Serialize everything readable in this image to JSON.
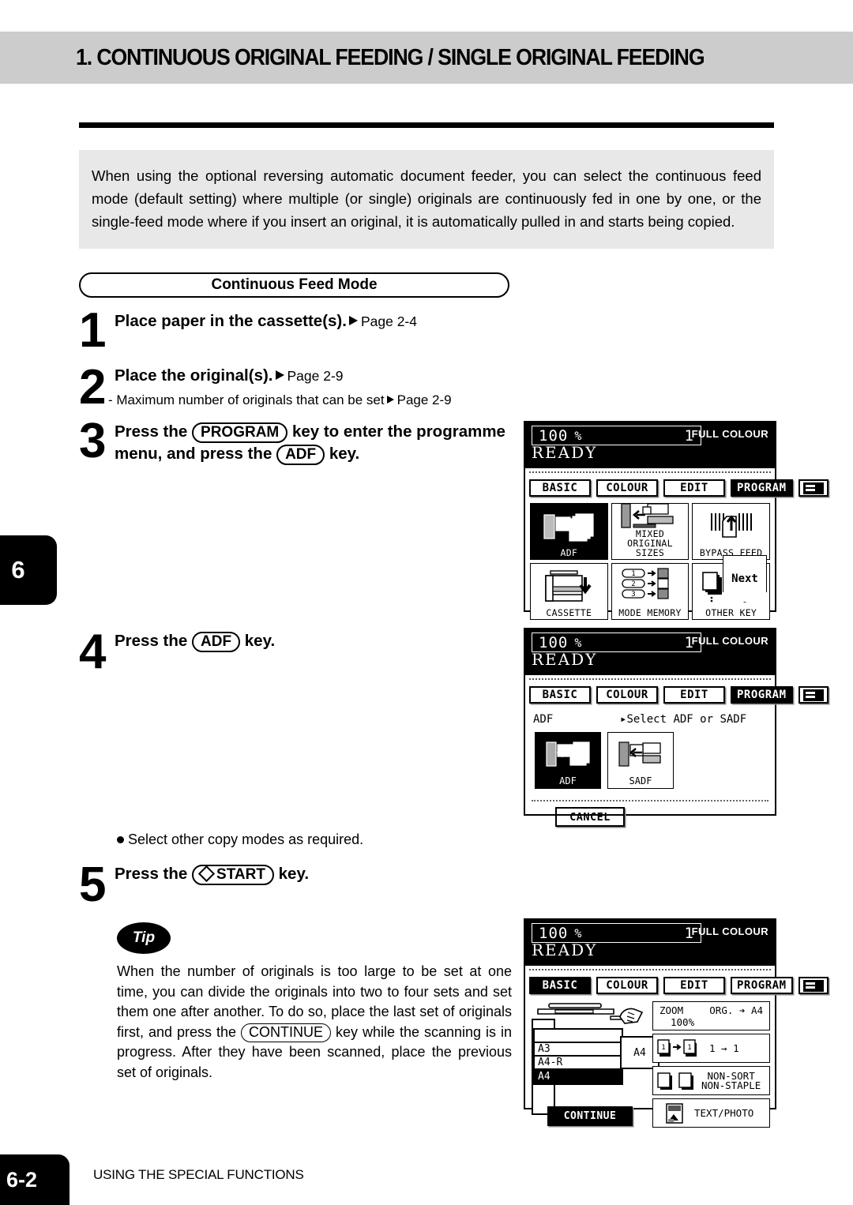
{
  "header": {
    "title": "1. CONTINUOUS ORIGINAL FEEDING / SINGLE ORIGINAL FEEDING"
  },
  "intro": {
    "text": "When using the optional reversing automatic document feeder, you can select the continuous feed mode (default setting) where multiple (or single) originals are continuously fed in one by one, or the single-feed mode where if you insert an original, it is automatically pulled in and starts being copied."
  },
  "mode_pill": {
    "label": "Continuous Feed Mode"
  },
  "steps": [
    {
      "num": "1",
      "title": "Place paper in the cassette(s).",
      "ref": "Page 2-4"
    },
    {
      "num": "2",
      "title": "Place the original(s).",
      "ref": "Page 2-9",
      "note_prefix": "-  Maximum number of originals that can be set",
      "note_ref": "Page 2-9"
    },
    {
      "num": "3",
      "title_a": "Press the",
      "key_a": "PROGRAM",
      "title_b": "key to enter the programme",
      "title_c": "menu, and press the",
      "key_b": "ADF",
      "title_d": "key."
    },
    {
      "num": "4",
      "title_a": "Press the",
      "key_a": "ADF",
      "title_b": "key."
    },
    {
      "num": "5",
      "title_a": "Press the",
      "key_a": "START",
      "title_b": "key."
    }
  ],
  "bullet": {
    "text": "Select other copy modes as required."
  },
  "tip": {
    "badge": "Tip",
    "text_a": "When the number of originals is too large to be set at one time, you can divide the originals into two to four sets and set them one after another.  To do so, place the last set of originals first, and press the",
    "key": "CONTINUE",
    "text_b": "key while the scanning is in progress.  After they have been scanned, place the previous set of originals."
  },
  "lcd_common": {
    "ratio": "100",
    "percent_symbol": "%",
    "copy_count": "1",
    "colour_mode": "FULL COLOUR",
    "status": "READY",
    "tabs": [
      "BASIC",
      "COLOUR",
      "EDIT",
      "PROGRAM"
    ],
    "keyboard_icon": "keyboard-icon"
  },
  "lcd_panel_1": {
    "selected_tab": "PROGRAM",
    "buttons": [
      {
        "label": "ADF",
        "selected": true,
        "icon": "adf-icon"
      },
      {
        "label": "MIXED\nORIGINAL SIZES",
        "label_l1": "MIXED",
        "label_l2": "ORIGINAL SIZES",
        "selected": false,
        "icon": "mixed-original-sizes-icon"
      },
      {
        "label": "BYPASS FEED",
        "selected": false,
        "icon": "bypass-feed-icon"
      },
      {
        "label": "CASSETTE",
        "selected": false,
        "icon": "cassette-icon"
      },
      {
        "label": "MODE MEMORY",
        "selected": false,
        "icon": "mode-memory-icon"
      },
      {
        "label": "OTHER KEY",
        "selected": false,
        "icon": "other-key-icon"
      }
    ],
    "next_label": "Next"
  },
  "lcd_panel_2": {
    "selected_tab": "PROGRAM",
    "mode_label": "ADF",
    "prompt": "Select ADF or SADF",
    "buttons": [
      {
        "label": "ADF",
        "selected": true,
        "icon": "adf-icon"
      },
      {
        "label": "SADF",
        "selected": false,
        "icon": "sadf-icon"
      }
    ],
    "cancel_label": "CANCEL"
  },
  "lcd_panel_3": {
    "selected_tab": "BASIC",
    "cassettes": [
      {
        "label": "",
        "selected": false
      },
      {
        "label": "A3",
        "selected": false
      },
      {
        "label": "A4-R",
        "selected": false
      },
      {
        "label": "A4",
        "selected": true
      }
    ],
    "paper_tag": "A4",
    "continue_label": "CONTINUE",
    "settings": [
      {
        "name": "zoom",
        "label": "ZOOM",
        "value": "100%",
        "right": "ORG. ➔ A4"
      },
      {
        "name": "duplex",
        "value": "1 → 1"
      },
      {
        "name": "finishing",
        "line1": "NON-SORT",
        "line2": "NON-STAPLE"
      },
      {
        "name": "original-mode",
        "value": "TEXT/PHOTO"
      }
    ]
  },
  "side_tab": {
    "chapter": "6"
  },
  "footer": {
    "page": "6-2",
    "section": "USING THE SPECIAL FUNCTIONS"
  }
}
